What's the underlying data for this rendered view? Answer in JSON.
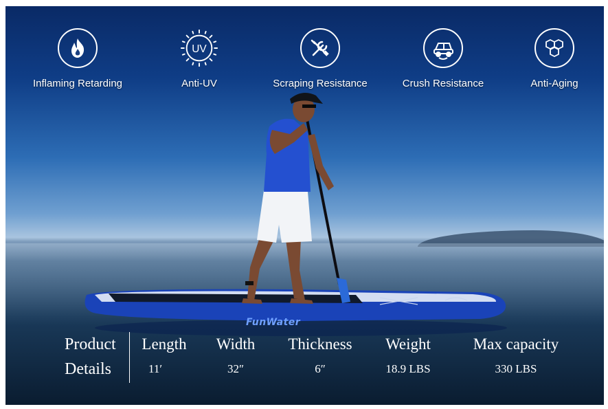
{
  "features": [
    {
      "label": "Inflaming Retarding",
      "icon": "flame-icon"
    },
    {
      "label": "Anti-UV",
      "icon": "uv-sun-icon"
    },
    {
      "label": "Scraping Resistance",
      "icon": "tools-icon"
    },
    {
      "label": "Crush Resistance",
      "icon": "car-crush-icon"
    },
    {
      "label": "Anti-Aging",
      "icon": "hexagon-molecule-icon"
    }
  ],
  "uv_text": "UV",
  "brand": "FunWater",
  "specs": {
    "heading_line1": "Product",
    "heading_line2": "Details",
    "columns": [
      {
        "name": "Length",
        "value": "11′"
      },
      {
        "name": "Width",
        "value": "32″"
      },
      {
        "name": "Thickness",
        "value": "6″"
      },
      {
        "name": "Weight",
        "value": "18.9 LBS"
      },
      {
        "name": "Max capacity",
        "value": "330 LBS"
      }
    ]
  },
  "colors": {
    "sky_top": "#0a2a66",
    "horizon": "#a9c4df",
    "board_blue": "#1a43b8",
    "board_white": "#e8eef8",
    "shirt_blue": "#2450d0",
    "shorts_white": "#f2f4f7"
  }
}
